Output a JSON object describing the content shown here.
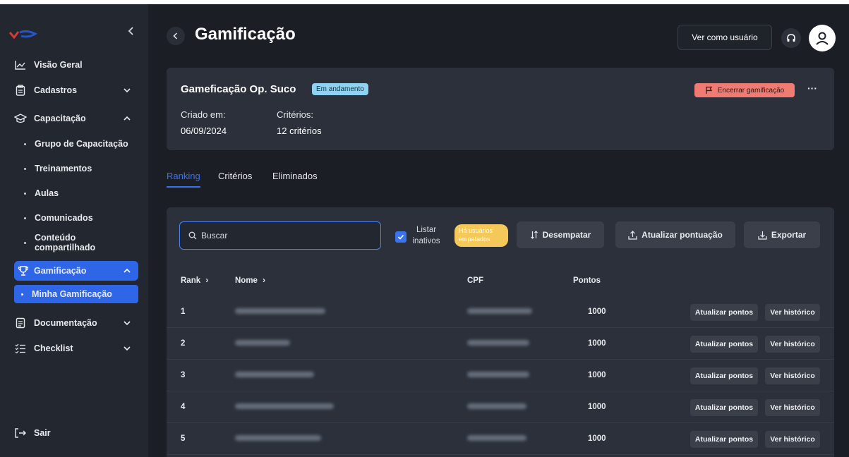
{
  "sidebar": {
    "items": [
      {
        "label": "Visão Geral",
        "icon": "chart-line-icon"
      },
      {
        "label": "Cadastros",
        "icon": "clipboard-icon"
      },
      {
        "label": "Capacitação",
        "icon": "graduation-cap-icon"
      },
      {
        "label": "Grupo de Capacitação"
      },
      {
        "label": "Treinamentos"
      },
      {
        "label": "Aulas"
      },
      {
        "label": "Comunicados"
      },
      {
        "label": "Conteúdo compartilhado"
      },
      {
        "label": "Gamificação",
        "icon": "trophy-icon"
      },
      {
        "label": "Minha Gamificação"
      },
      {
        "label": "Documentação",
        "icon": "document-icon"
      },
      {
        "label": "Checklist",
        "icon": "checklist-icon"
      }
    ],
    "logout": "Sair"
  },
  "header": {
    "title": "Gamificação",
    "view_as_user": "Ver como usuário"
  },
  "card": {
    "name": "Gameficação Op. Suco",
    "status": "Em andamento",
    "end_button": "Encerrar gamificação",
    "more": "···",
    "created_label": "Criado em:",
    "created_value": "06/09/2024",
    "criteria_label": "Critérios:",
    "criteria_value": "12 critérios"
  },
  "tabs": [
    "Ranking",
    "Critérios",
    "Eliminados"
  ],
  "toolbar": {
    "search_placeholder": "Buscar",
    "list_inactive": "Listar inativos",
    "tie_badge": "Há usuários empatados",
    "untie": "Desempatar",
    "update_score": "Atualizar pontuação",
    "export": "Exportar"
  },
  "table": {
    "headers": {
      "rank": "Rank",
      "name": "Nome",
      "cpf": "CPF",
      "points": "Pontos"
    },
    "row_actions": {
      "update": "Atualizar pontos",
      "history": "Ver histórico"
    },
    "rows": [
      {
        "rank": "1",
        "points": "1000"
      },
      {
        "rank": "2",
        "points": "1000"
      },
      {
        "rank": "3",
        "points": "1000"
      },
      {
        "rank": "4",
        "points": "1000"
      },
      {
        "rank": "5",
        "points": "1000"
      }
    ]
  },
  "colors": {
    "accent": "#2f66e8",
    "danger": "#ef7b73",
    "warning": "#f5c85a",
    "badge": "#8ed4f2"
  }
}
